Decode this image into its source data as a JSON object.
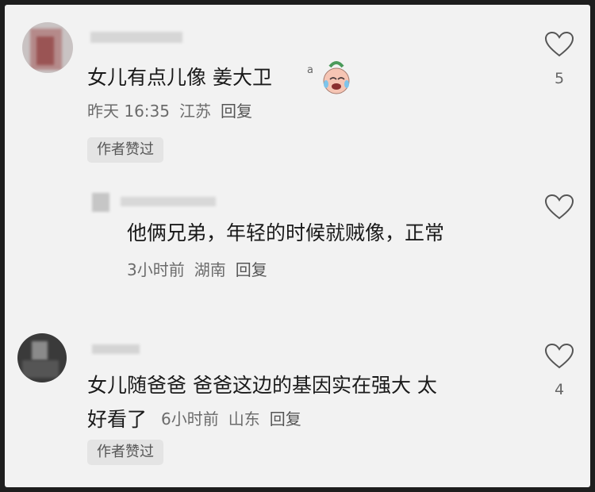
{
  "comments": [
    {
      "text": "女儿有点儿像 姜大卫",
      "time": "昨天 16:35",
      "location": "江苏",
      "reply_label": "回复",
      "badge": "作者赞过",
      "likes": "5",
      "emoji": "laughing-cry-face-icon",
      "replies": [
        {
          "text": "他俩兄弟，年轻的时候就贼像，正常",
          "time": "3小时前",
          "location": "湖南",
          "reply_label": "回复",
          "likes": ""
        }
      ]
    },
    {
      "text_line1": "女儿随爸爸 爸爸这边的基因实在强大 太",
      "text_line2": "好看了",
      "time": "6小时前",
      "location": "山东",
      "reply_label": "回复",
      "badge": "作者赞过",
      "likes": "4"
    }
  ],
  "colors": {
    "background": "#f2f2f2",
    "frame": "#1e1e1e",
    "badge_bg": "#e4e4e4",
    "heart_stroke": "#555555"
  }
}
